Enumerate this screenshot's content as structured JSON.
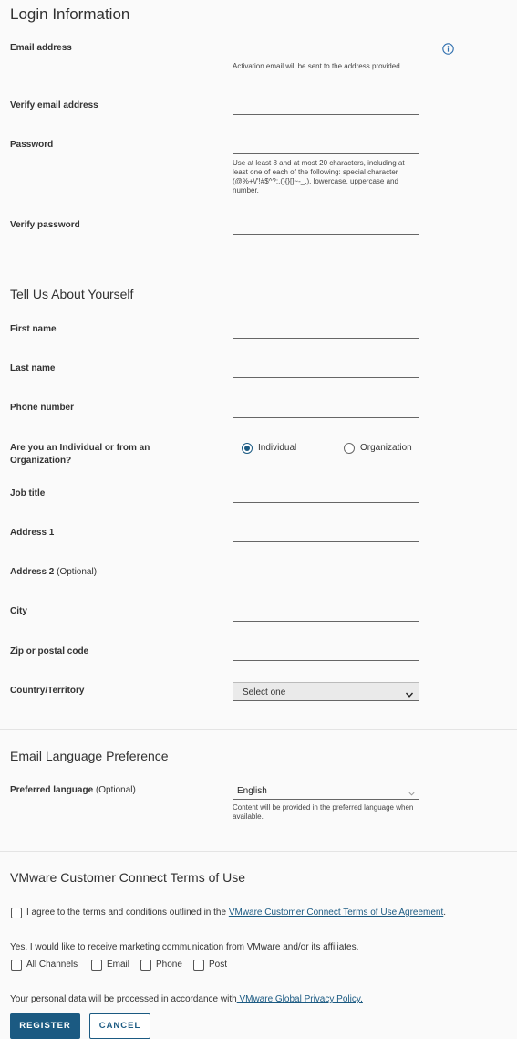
{
  "login": {
    "heading": "Login Information",
    "email_label": "Email address",
    "email_help": "Activation email will be sent to the address provided.",
    "verify_email_label": "Verify email address",
    "password_label": "Password",
    "password_help": "Use at least 8 and at most 20 characters, including at least one of each of the following: special character (@%+\\/'!#$^?:,(){}[]~-_.), lowercase, uppercase and number.",
    "verify_password_label": "Verify password"
  },
  "about": {
    "heading": "Tell Us About Yourself",
    "first_name_label": "First name",
    "last_name_label": "Last name",
    "phone_label": "Phone number",
    "type_question": "Are you an Individual or from an Organization?",
    "type_options": [
      "Individual",
      "Organization"
    ],
    "type_selected": "Individual",
    "job_title_label": "Job title",
    "address1_label": "Address 1",
    "address2_label": "Address 2",
    "address2_optional": "(Optional)",
    "city_label": "City",
    "zip_label": "Zip or postal code",
    "country_label": "Country/Territory",
    "country_value": "Select one"
  },
  "language": {
    "heading": "Email Language Preference",
    "label": "Preferred language",
    "optional": "(Optional)",
    "value": "English",
    "help": "Content will be provided in the preferred language when available."
  },
  "terms": {
    "heading": "VMware Customer Connect Terms of Use",
    "agree_text": "I agree to the terms and conditions outlined in the ",
    "agree_link": "VMware Customer Connect Terms of Use Agreement",
    "agree_end": ".",
    "marketing_text": "Yes, I would like to receive marketing communication from VMware and/or its affiliates.",
    "channels": [
      "All Channels",
      "Email",
      "Phone",
      "Post"
    ],
    "privacy_text": "Your personal data will be processed in accordance with",
    "privacy_link": " VMware Global Privacy Policy."
  },
  "buttons": {
    "register": "REGISTER",
    "cancel": "CANCEL"
  },
  "colors": {
    "accent": "#1b5a82",
    "info_icon": "#2f6fae"
  },
  "icons": {
    "info": "info-icon",
    "select_chevron": "chevron-down-icon"
  }
}
